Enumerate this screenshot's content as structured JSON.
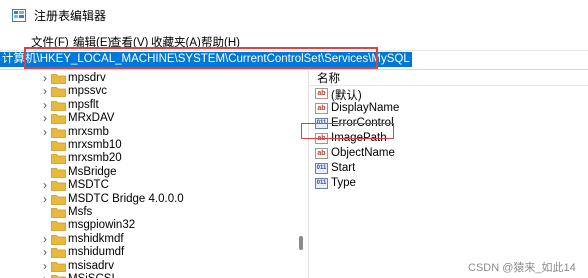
{
  "window": {
    "title": "注册表编辑器"
  },
  "menu": [
    {
      "label": "文件(F)"
    },
    {
      "label": "编辑(E)"
    },
    {
      "label": "查看(V)"
    },
    {
      "label": "收藏夹(A)"
    },
    {
      "label": "帮助(H)"
    }
  ],
  "address": {
    "path": "计算机\\HKEY_LOCAL_MACHINE\\SYSTEM\\CurrentControlSet\\Services\\MySQL"
  },
  "tree": {
    "items": [
      {
        "label": "mpsdrv",
        "expandable": true
      },
      {
        "label": "mpssvc",
        "expandable": true
      },
      {
        "label": "mpsflt",
        "expandable": true
      },
      {
        "label": "MRxDAV",
        "expandable": true
      },
      {
        "label": "mrxsmb",
        "expandable": true
      },
      {
        "label": "mrxsmb10",
        "expandable": false
      },
      {
        "label": "mrxsmb20",
        "expandable": false
      },
      {
        "label": "MsBridge",
        "expandable": false
      },
      {
        "label": "MSDTC",
        "expandable": true
      },
      {
        "label": "MSDTC Bridge 4.0.0.0",
        "expandable": true
      },
      {
        "label": "Msfs",
        "expandable": false
      },
      {
        "label": "msgpiowin32",
        "expandable": false
      },
      {
        "label": "mshidkmdf",
        "expandable": true
      },
      {
        "label": "mshidumdf",
        "expandable": true
      },
      {
        "label": "msisadrv",
        "expandable": true
      },
      {
        "label": "MSiSCSI",
        "expandable": true
      }
    ]
  },
  "values": {
    "column_name": "名称",
    "items": [
      {
        "name": "(默认)",
        "type": "string"
      },
      {
        "name": "DisplayName",
        "type": "string"
      },
      {
        "name": "ErrorControl",
        "type": "binary"
      },
      {
        "name": "ImagePath",
        "type": "string"
      },
      {
        "name": "ObjectName",
        "type": "string"
      },
      {
        "name": "Start",
        "type": "binary"
      },
      {
        "name": "Type",
        "type": "binary"
      }
    ]
  },
  "watermark": "CSDN @猿来_如此14",
  "colors": {
    "selection": "#0078d7",
    "highlight_box": "#e04040",
    "folder": "#e8b93c"
  },
  "icons": {
    "string_value": "ab-icon",
    "binary_value": "binary-icon",
    "folder": "folder-icon",
    "app": "registry-editor-icon"
  }
}
